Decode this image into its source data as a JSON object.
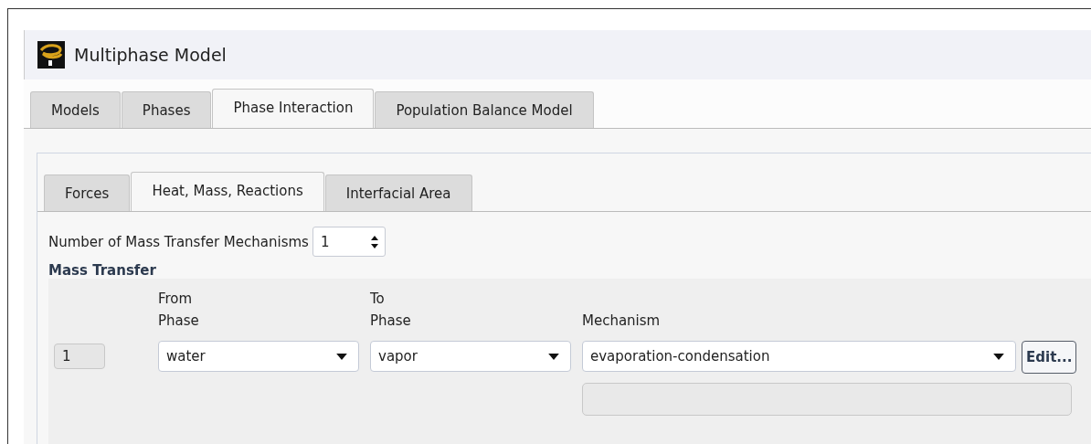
{
  "window": {
    "title": "Multiphase Model"
  },
  "tabs": [
    {
      "label": "Models",
      "selected": false
    },
    {
      "label": "Phases",
      "selected": false
    },
    {
      "label": "Phase Interaction",
      "selected": true
    },
    {
      "label": "Population Balance Model",
      "selected": false
    }
  ],
  "subtabs": [
    {
      "label": "Forces",
      "selected": false
    },
    {
      "label": "Heat, Mass, Reactions",
      "selected": true
    },
    {
      "label": "Interfacial Area",
      "selected": false
    }
  ],
  "mechanism_count": {
    "label": "Number of Mass Transfer Mechanisms",
    "value": "1"
  },
  "mass_transfer": {
    "title": "Mass Transfer",
    "columns": [
      {
        "line1": "From",
        "line2": "Phase"
      },
      {
        "line1": "To",
        "line2": "Phase"
      },
      {
        "line1": "Mechanism"
      }
    ],
    "rows": [
      {
        "index": "1",
        "from_phase": "water",
        "to_phase": "vapor",
        "mechanism": "evaporation-condensation",
        "button": "Edit..."
      }
    ]
  }
}
